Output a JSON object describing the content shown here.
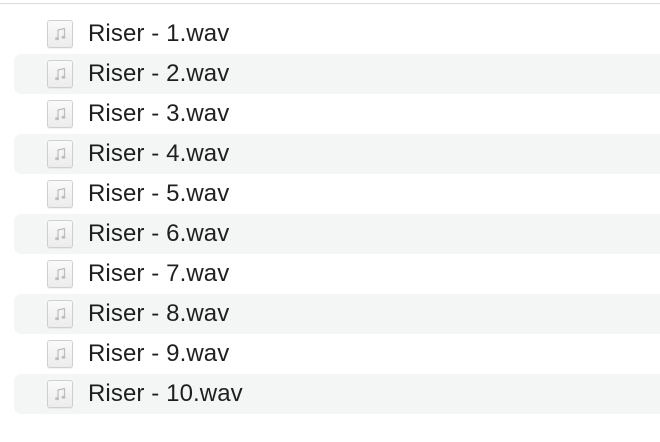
{
  "files": [
    {
      "name": "Riser - 1.wav",
      "icon": "audio-file-icon"
    },
    {
      "name": "Riser - 2.wav",
      "icon": "audio-file-icon"
    },
    {
      "name": "Riser - 3.wav",
      "icon": "audio-file-icon"
    },
    {
      "name": "Riser - 4.wav",
      "icon": "audio-file-icon"
    },
    {
      "name": "Riser - 5.wav",
      "icon": "audio-file-icon"
    },
    {
      "name": "Riser - 6.wav",
      "icon": "audio-file-icon"
    },
    {
      "name": "Riser - 7.wav",
      "icon": "audio-file-icon"
    },
    {
      "name": "Riser - 8.wav",
      "icon": "audio-file-icon"
    },
    {
      "name": "Riser - 9.wav",
      "icon": "audio-file-icon"
    },
    {
      "name": "Riser - 10.wav",
      "icon": "audio-file-icon"
    }
  ],
  "colors": {
    "row_alt_background": "#f4f5f5",
    "text": "#1f1f1f",
    "icon_border": "#cfcfcf",
    "music_note": "#bdbdbd"
  }
}
